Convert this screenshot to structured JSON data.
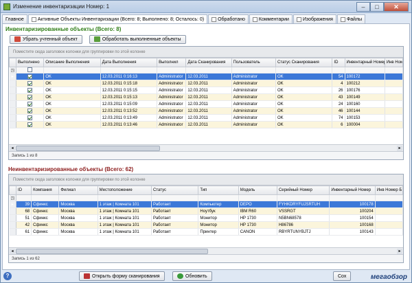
{
  "window": {
    "title": "Изменение инвентаризации Номер: 1",
    "min": "–",
    "max": "□",
    "close": "✕"
  },
  "tabs": [
    {
      "label": "Главное"
    },
    {
      "label": "Активные Объекты Инвентаризации (Всего: 8; Выполнено: 8; Осталось: 0)"
    },
    {
      "label": "Обработано"
    },
    {
      "label": "Комментарии"
    },
    {
      "label": "Изображения"
    },
    {
      "label": "Файлы"
    }
  ],
  "inventoried": {
    "title": "Инвентаризированные объекты (Всего: 8)",
    "remove_button": "Убрать учтенный объект",
    "process_button": "Обработать выполненные объекты",
    "group_hint": "Поместите сюда заголовок колонки для группировки по этой колонке",
    "columns": [
      "Выполнено",
      "Описание Выполнения",
      "Дата Выполнения",
      "Выполнил",
      "Дата Сканирования",
      "Пользователь",
      "Статус Сканирования",
      "ID",
      "Инвентарный Номер",
      "Инв Ном"
    ],
    "rows": [
      {
        "desc": "OK",
        "date_done": "12.03.2011 0:16:13",
        "by": "Administrator",
        "date_scan": "12.03.2011",
        "user": "Administrator",
        "status": "OK",
        "id": "54",
        "inv": "100172"
      },
      {
        "desc": "OK",
        "date_done": "12.03.2011 0:15:18",
        "by": "Administrator",
        "date_scan": "12.03.2011",
        "user": "Administrator",
        "status": "OK",
        "id": "4",
        "inv": "100212"
      },
      {
        "desc": "OK",
        "date_done": "12.03.2011 0:15:15",
        "by": "Administrator",
        "date_scan": "12.03.2011",
        "user": "Administrator",
        "status": "OK",
        "id": "26",
        "inv": "100176"
      },
      {
        "desc": "OK",
        "date_done": "12.03.2011 0:15:13",
        "by": "Administrator",
        "date_scan": "12.03.2011",
        "user": "Administrator",
        "status": "OK",
        "id": "43",
        "inv": "100149"
      },
      {
        "desc": "OK",
        "date_done": "12.03.2011 0:15:09",
        "by": "Administrator",
        "date_scan": "12.03.2011",
        "user": "Administrator",
        "status": "OK",
        "id": "24",
        "inv": "100160"
      },
      {
        "desc": "OK",
        "date_done": "12.03.2011 0:13:52",
        "by": "Administrator",
        "date_scan": "12.03.2011",
        "user": "Administrator",
        "status": "OK",
        "id": "46",
        "inv": "100144"
      },
      {
        "desc": "OK",
        "date_done": "12.03.2011 0:13:49",
        "by": "Administrator",
        "date_scan": "12.03.2011",
        "user": "Administrator",
        "status": "OK",
        "id": "74",
        "inv": "100153"
      },
      {
        "desc": "OK",
        "date_done": "12.03.2011 0:13:46",
        "by": "Administrator",
        "date_scan": "12.03.2011",
        "user": "Administrator",
        "status": "OK",
        "id": "6",
        "inv": "100004"
      }
    ],
    "record_info": "Запись 1 из 8"
  },
  "not_inventoried": {
    "title": "Неинвентаризированные объекты (Всего: 62)",
    "group_hint": "Поместите сюда заголовок колонки для группировки по этой колонке",
    "columns": [
      "ID",
      "Компания",
      "Филиал",
      "Местоположение",
      "Статус",
      "Тип",
      "Модель",
      "Серийный Номер",
      "Инвентарный Номер",
      "Инв Номер Б"
    ],
    "rows": [
      {
        "id": "39",
        "company": "Сфинкс",
        "branch": "Москва",
        "location": "1 этаж | Комната 101",
        "status": "Работает",
        "type": "Компьютер",
        "model": "DEPO",
        "serial": "FYHKDRYFUJSRTUH",
        "inv": "100178"
      },
      {
        "id": "68",
        "company": "Сфинкс",
        "branch": "Москва",
        "location": "1 этаж | Комната 101",
        "status": "Работает",
        "type": "Ноутбук",
        "model": "IBM R60",
        "serial": "VSSRGT",
        "inv": "100204"
      },
      {
        "id": "51",
        "company": "Сфинкс",
        "branch": "Москва",
        "location": "1 этаж | Комната 101",
        "status": "Работает",
        "type": "Монитор",
        "model": "HP 1730",
        "serial": "N5BN68578",
        "inv": "100154"
      },
      {
        "id": "42",
        "company": "Сфинкс",
        "branch": "Москва",
        "location": "1 этаж | Комната 101",
        "status": "Работает",
        "type": "Монитор",
        "model": "HP 1730",
        "serial": "H86786",
        "inv": "100168"
      },
      {
        "id": "61",
        "company": "Сфинкс",
        "branch": "Москва",
        "location": "1 этаж | Комната 101",
        "status": "Работает",
        "type": "Принтер",
        "model": "CANON",
        "serial": "RBYRTUNYBJTJ",
        "inv": "100143"
      }
    ],
    "record_info": "Запись 1 из 62"
  },
  "bottom": {
    "scan_button": "Открыть форму сканирования",
    "refresh_button": "Обновить",
    "save_button": "Сох",
    "logo": "мегаобзор"
  }
}
